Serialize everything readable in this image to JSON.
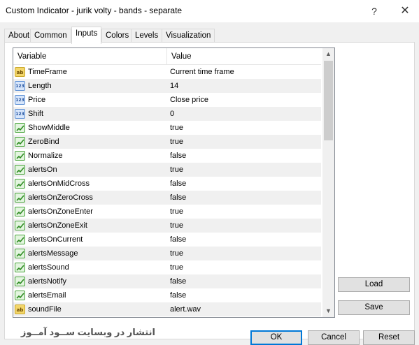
{
  "window": {
    "title": "Custom Indicator - jurik volty - bands - separate",
    "help_label": "?",
    "close_label": "✕"
  },
  "tabs": [
    {
      "label": "About"
    },
    {
      "label": "Common"
    },
    {
      "label": "Inputs"
    },
    {
      "label": "Colors"
    },
    {
      "label": "Levels"
    },
    {
      "label": "Visualization"
    }
  ],
  "active_tab": "Inputs",
  "table": {
    "headers": {
      "variable": "Variable",
      "value": "Value"
    },
    "rows": [
      {
        "type": "string",
        "icon_text": "ab",
        "name": "TimeFrame",
        "value": "Current time frame"
      },
      {
        "type": "number",
        "icon_text": "123",
        "name": "Length",
        "value": "14"
      },
      {
        "type": "number",
        "icon_text": "123",
        "name": "Price",
        "value": "Close price"
      },
      {
        "type": "number",
        "icon_text": "123",
        "name": "Shift",
        "value": "0"
      },
      {
        "type": "bool",
        "icon_text": "",
        "name": "ShowMiddle",
        "value": "true"
      },
      {
        "type": "bool",
        "icon_text": "",
        "name": "ZeroBind",
        "value": "true"
      },
      {
        "type": "bool",
        "icon_text": "",
        "name": "Normalize",
        "value": "false"
      },
      {
        "type": "bool",
        "icon_text": "",
        "name": "alertsOn",
        "value": "true"
      },
      {
        "type": "bool",
        "icon_text": "",
        "name": "alertsOnMidCross",
        "value": "false"
      },
      {
        "type": "bool",
        "icon_text": "",
        "name": "alertsOnZeroCross",
        "value": "false"
      },
      {
        "type": "bool",
        "icon_text": "",
        "name": "alertsOnZoneEnter",
        "value": "true"
      },
      {
        "type": "bool",
        "icon_text": "",
        "name": "alertsOnZoneExit",
        "value": "true"
      },
      {
        "type": "bool",
        "icon_text": "",
        "name": "alertsOnCurrent",
        "value": "false"
      },
      {
        "type": "bool",
        "icon_text": "",
        "name": "alertsMessage",
        "value": "true"
      },
      {
        "type": "bool",
        "icon_text": "",
        "name": "alertsSound",
        "value": "true"
      },
      {
        "type": "bool",
        "icon_text": "",
        "name": "alertsNotify",
        "value": "false"
      },
      {
        "type": "bool",
        "icon_text": "",
        "name": "alertsEmail",
        "value": "false"
      },
      {
        "type": "string",
        "icon_text": "ab",
        "name": "soundFile",
        "value": "alert.wav"
      }
    ]
  },
  "buttons": {
    "load": "Load",
    "save": "Save",
    "ok": "OK",
    "cancel": "Cancel",
    "reset": "Reset"
  },
  "footer_text": "انتشار در وبسایت ســود آمــوز",
  "scroll": {
    "up_arrow": "▲",
    "down_arrow": "▼"
  }
}
